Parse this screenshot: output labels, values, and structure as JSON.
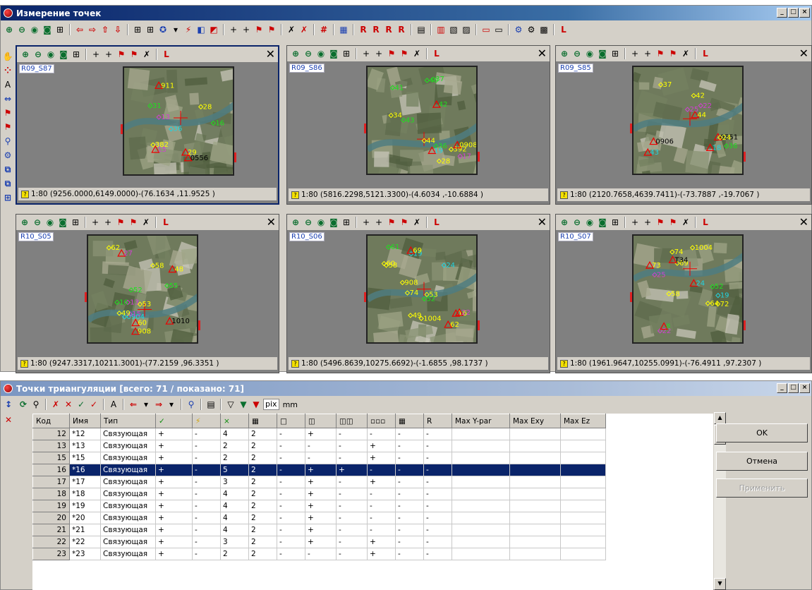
{
  "main_window": {
    "title": "Измерение точек",
    "red_letter": "L"
  },
  "panes": [
    {
      "id": "R09_S87",
      "label": "R09_S87",
      "status": "1:80 (9256.0000,6149.0000)-(76.1634 ,11.9525 )",
      "active": true,
      "points": [
        {
          "t": "0556",
          "c": "#000"
        },
        {
          "t": "911",
          "c": "#ffff00"
        },
        {
          "t": "382",
          "c": "#ffff00"
        },
        {
          "t": "31",
          "c": "#1fe01f"
        },
        {
          "t": "28",
          "c": "#ffff00"
        },
        {
          "t": "29",
          "c": "#ffff00"
        },
        {
          "t": "16",
          "c": "#1fe01f"
        },
        {
          "t": "13",
          "c": "#d040d0"
        },
        {
          "t": "36",
          "c": "#22d3e0"
        },
        {
          "t": "15",
          "c": "#d040d0"
        }
      ]
    },
    {
      "id": "R09_S86",
      "label": "R09_S86",
      "status": "1:80 (5816.2298,5121.3300)-(4.6034 ,-10.6884 )",
      "active": false,
      "points": [
        {
          "t": "392",
          "c": "#ffff00"
        },
        {
          "t": "0908",
          "c": "#ffff00"
        },
        {
          "t": "44",
          "c": "#ffff00"
        },
        {
          "t": "40",
          "c": "#1fe01f"
        },
        {
          "t": "36",
          "c": "#1fe01f"
        },
        {
          "t": "42",
          "c": "#1fe01f"
        },
        {
          "t": "28",
          "c": "#ffff00"
        },
        {
          "t": "17",
          "c": "#d040d0"
        },
        {
          "t": "41",
          "c": "#1fe01f"
        },
        {
          "t": "19",
          "c": "#22d3e0"
        },
        {
          "t": "34",
          "c": "#ffff00"
        },
        {
          "t": "43",
          "c": "#1fe01f"
        },
        {
          "t": "37",
          "c": "#1fe01f"
        }
      ]
    },
    {
      "id": "R09_S85",
      "label": "R09_S85",
      "status": "1:80 (2120.7658,4639.7411)-(-73.7887 ,-19.7067 )",
      "active": false,
      "points": [
        {
          "t": "0906",
          "c": "#000"
        },
        {
          "t": "44",
          "c": "#ffff00"
        },
        {
          "t": "0551",
          "c": "#000"
        },
        {
          "t": "36",
          "c": "#1fe01f"
        },
        {
          "t": "42",
          "c": "#ffff00"
        },
        {
          "t": "18",
          "c": "#22d3e0"
        },
        {
          "t": "25",
          "c": "#d040d0"
        },
        {
          "t": "22",
          "c": "#d040d0"
        },
        {
          "t": "24",
          "c": "#ffff00"
        },
        {
          "t": "43",
          "c": "#22d3e0"
        },
        {
          "t": "37",
          "c": "#ffff00"
        }
      ]
    },
    {
      "id": "R10_S05",
      "label": "R10_S05",
      "status": "1:80 (9247.3317,10211.3001)-(77.2159 ,96.3351 )",
      "active": false,
      "points": [
        {
          "t": "13",
          "c": "#d040d0"
        },
        {
          "t": "27",
          "c": "#d040d0"
        },
        {
          "t": "16",
          "c": "#1fe01f"
        },
        {
          "t": "52",
          "c": "#1fe01f"
        },
        {
          "t": "53",
          "c": "#ffff00"
        },
        {
          "t": "48",
          "c": "#ffff00"
        },
        {
          "t": "0904",
          "c": "#22d3e0"
        },
        {
          "t": "15",
          "c": "#d040d0"
        },
        {
          "t": "58",
          "c": "#ffff00"
        },
        {
          "t": "60",
          "c": "#ffff00"
        },
        {
          "t": "49",
          "c": "#ffff00"
        },
        {
          "t": "1010",
          "c": "#000"
        },
        {
          "t": "62",
          "c": "#ffff00"
        },
        {
          "t": "908",
          "c": "#ffff00"
        },
        {
          "t": "55",
          "c": "#1fe01f"
        }
      ]
    },
    {
      "id": "R10_S06",
      "label": "R10_S06",
      "status": "1:80 (5496.8639,10275.6692)-(-1.6855 ,98.1737 )",
      "active": false,
      "points": [
        {
          "t": "53",
          "c": "#ffff00"
        },
        {
          "t": "16",
          "c": "#ffff00"
        },
        {
          "t": "52",
          "c": "#1fe01f"
        },
        {
          "t": "24",
          "c": "#22d3e0"
        },
        {
          "t": "19",
          "c": "#22d3e0"
        },
        {
          "t": "22",
          "c": "#d040d0"
        },
        {
          "t": "58",
          "c": "#ffff00"
        },
        {
          "t": "60",
          "c": "#ffff00"
        },
        {
          "t": "49",
          "c": "#ffff00"
        },
        {
          "t": "62",
          "c": "#ffff00"
        },
        {
          "t": "908",
          "c": "#ffff00"
        },
        {
          "t": "61",
          "c": "#1fe01f"
        },
        {
          "t": "74",
          "c": "#ffff00"
        },
        {
          "t": "69",
          "c": "#ffff00"
        },
        {
          "t": "1004",
          "c": "#ffff00"
        }
      ]
    },
    {
      "id": "R10_S07",
      "label": "R10_S07",
      "status": "1:80 (1961.9647,10255.0991)-(-76.4911 ,97.2307 )",
      "active": false,
      "points": [
        {
          "t": "52",
          "c": "#1fe01f"
        },
        {
          "t": "24",
          "c": "#22d3e0"
        },
        {
          "t": "19",
          "c": "#22d3e0"
        },
        {
          "t": "22",
          "c": "#d040d0"
        },
        {
          "t": "58",
          "c": "#ffff00"
        },
        {
          "t": "73",
          "c": "#ffff00"
        },
        {
          "t": "72",
          "c": "#ffff00"
        },
        {
          "t": "64",
          "c": "#ffff00"
        },
        {
          "t": "25",
          "c": "#d040d0"
        },
        {
          "t": "8",
          "c": "#1fe01f"
        },
        {
          "t": "74",
          "c": "#ffff00"
        },
        {
          "t": "69",
          "c": "#ffff00"
        },
        {
          "t": "1004",
          "c": "#ffff00"
        },
        {
          "t": "T34",
          "c": "#000"
        }
      ]
    }
  ],
  "tri_window": {
    "title": "Точки триангуляции [всего: 71 / показано: 71]",
    "units": [
      "pix",
      "mm"
    ],
    "buttons": {
      "ok": "OK",
      "cancel": "Отмена",
      "apply": "Применить"
    },
    "columns": [
      "Код",
      "Имя",
      "Тип",
      "✓",
      "⚡",
      "×",
      "▦",
      "□",
      "◫",
      "◫◫",
      "▫▫▫",
      "▦",
      "R",
      "Max Y-par",
      "Max Exy",
      "Max Ez"
    ],
    "rows": [
      {
        "code": "12",
        "name": "*12",
        "type": "Связующая",
        "c1": "+",
        "c2": "-",
        "c3": "4",
        "c4": "2",
        "c5": "-",
        "c6": "+",
        "c7": "-",
        "c8": "-",
        "c9": "-",
        "c10": "-"
      },
      {
        "code": "13",
        "name": "*13",
        "type": "Связующая",
        "c1": "+",
        "c2": "-",
        "c3": "2",
        "c4": "2",
        "c5": "-",
        "c6": "-",
        "c7": "-",
        "c8": "+",
        "c9": "-",
        "c10": "-"
      },
      {
        "code": "15",
        "name": "*15",
        "type": "Связующая",
        "c1": "+",
        "c2": "-",
        "c3": "2",
        "c4": "2",
        "c5": "-",
        "c6": "-",
        "c7": "-",
        "c8": "+",
        "c9": "-",
        "c10": "-"
      },
      {
        "code": "16",
        "name": "*16",
        "type": "Связующая",
        "c1": "+",
        "c2": "-",
        "c3": "5",
        "c4": "2",
        "c5": "-",
        "c6": "+",
        "c7": "+",
        "c8": "-",
        "c9": "-",
        "c10": "-",
        "selected": true
      },
      {
        "code": "17",
        "name": "*17",
        "type": "Связующая",
        "c1": "+",
        "c2": "-",
        "c3": "3",
        "c4": "2",
        "c5": "-",
        "c6": "+",
        "c7": "-",
        "c8": "+",
        "c9": "-",
        "c10": "-"
      },
      {
        "code": "18",
        "name": "*18",
        "type": "Связующая",
        "c1": "+",
        "c2": "-",
        "c3": "4",
        "c4": "2",
        "c5": "-",
        "c6": "+",
        "c7": "-",
        "c8": "-",
        "c9": "-",
        "c10": "-"
      },
      {
        "code": "19",
        "name": "*19",
        "type": "Связующая",
        "c1": "+",
        "c2": "-",
        "c3": "4",
        "c4": "2",
        "c5": "-",
        "c6": "+",
        "c7": "-",
        "c8": "-",
        "c9": "-",
        "c10": "-"
      },
      {
        "code": "20",
        "name": "*20",
        "type": "Связующая",
        "c1": "+",
        "c2": "-",
        "c3": "4",
        "c4": "2",
        "c5": "-",
        "c6": "+",
        "c7": "-",
        "c8": "-",
        "c9": "-",
        "c10": "-"
      },
      {
        "code": "21",
        "name": "*21",
        "type": "Связующая",
        "c1": "+",
        "c2": "-",
        "c3": "4",
        "c4": "2",
        "c5": "-",
        "c6": "+",
        "c7": "-",
        "c8": "-",
        "c9": "-",
        "c10": "-"
      },
      {
        "code": "22",
        "name": "*22",
        "type": "Связующая",
        "c1": "+",
        "c2": "-",
        "c3": "3",
        "c4": "2",
        "c5": "-",
        "c6": "+",
        "c7": "-",
        "c8": "+",
        "c9": "-",
        "c10": "-"
      },
      {
        "code": "23",
        "name": "*23",
        "type": "Связующая",
        "c1": "+",
        "c2": "-",
        "c3": "2",
        "c4": "2",
        "c5": "-",
        "c6": "-",
        "c7": "-",
        "c8": "+",
        "c9": "-",
        "c10": "-"
      }
    ]
  }
}
